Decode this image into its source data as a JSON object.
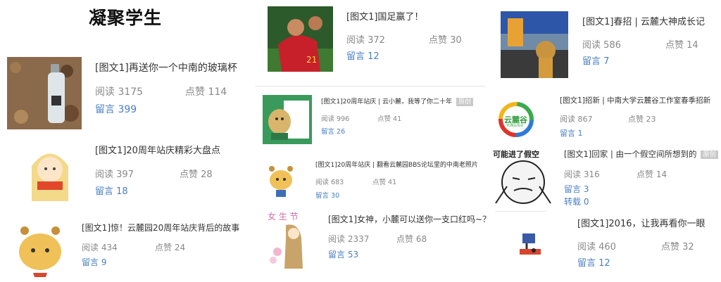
{
  "section": {
    "title": "凝聚学生"
  },
  "articles": [
    {
      "title": "[图文1]再送你一个中南的玻璃杯",
      "reads": "阅读 3175",
      "likes": "点赞 114",
      "comments": "留言 399"
    },
    {
      "title": "[图文1]20周年站庆精彩大盘点",
      "reads": "阅读 397",
      "likes": "点赞 28",
      "comments": "留言 18"
    },
    {
      "title": "[图文1]惊！云麓园20周年站庆背后的故事",
      "reads": "阅读 434",
      "likes": "点赞 24",
      "comments": "留言 9"
    },
    {
      "title": "[图文1]国足赢了！",
      "reads": "阅读 372",
      "likes": "点赞 30",
      "comments": "留言 12"
    },
    {
      "title": "[图文1]20周年站庆 | 云小麓，我等了你二十年",
      "badge": "原创",
      "reads": "阅读 996",
      "likes": "点赞 41",
      "comments": "留言 26"
    },
    {
      "title": "[图文1]20周年站庆 | 翻看云麓园BBS论坛里的中南老照片",
      "reads": "阅读 683",
      "likes": "点赞 41",
      "comments": "留言 30"
    },
    {
      "title": "[图文1]女神，小麓可以送你一支口红吗~？",
      "reads": "阅读 2337",
      "likes": "点赞 68",
      "comments": "留言 53"
    },
    {
      "title": "[图文1]春招 | 云麓大神成长记",
      "reads": "阅读 586",
      "likes": "点赞 14",
      "comments": "留言 7"
    },
    {
      "title": "[图文1]招新 | 中南大学云麓谷工作室春季招新",
      "reads": "阅读 867",
      "likes": "点赞 23",
      "comments": "留言 1"
    },
    {
      "title": "[图文1]回家 | 由一个假空间所想到的",
      "badge": "原创",
      "reads": "阅读 316",
      "likes": "点赞 14",
      "comments": "留言 3",
      "shares": "转载 0"
    },
    {
      "title": "[图文1]2016，让我再看你一眼",
      "reads": "阅读 460",
      "likes": "点赞 32",
      "comments": "留言 12"
    }
  ],
  "thumb_text": {
    "yunlugu_logo": "云麓谷",
    "yunlugu_sub": "YUNLUGU",
    "meme_caption": "可能进了假空"
  },
  "colors": {
    "link": "#4a7fc1",
    "muted": "#888888",
    "text": "#333333"
  }
}
